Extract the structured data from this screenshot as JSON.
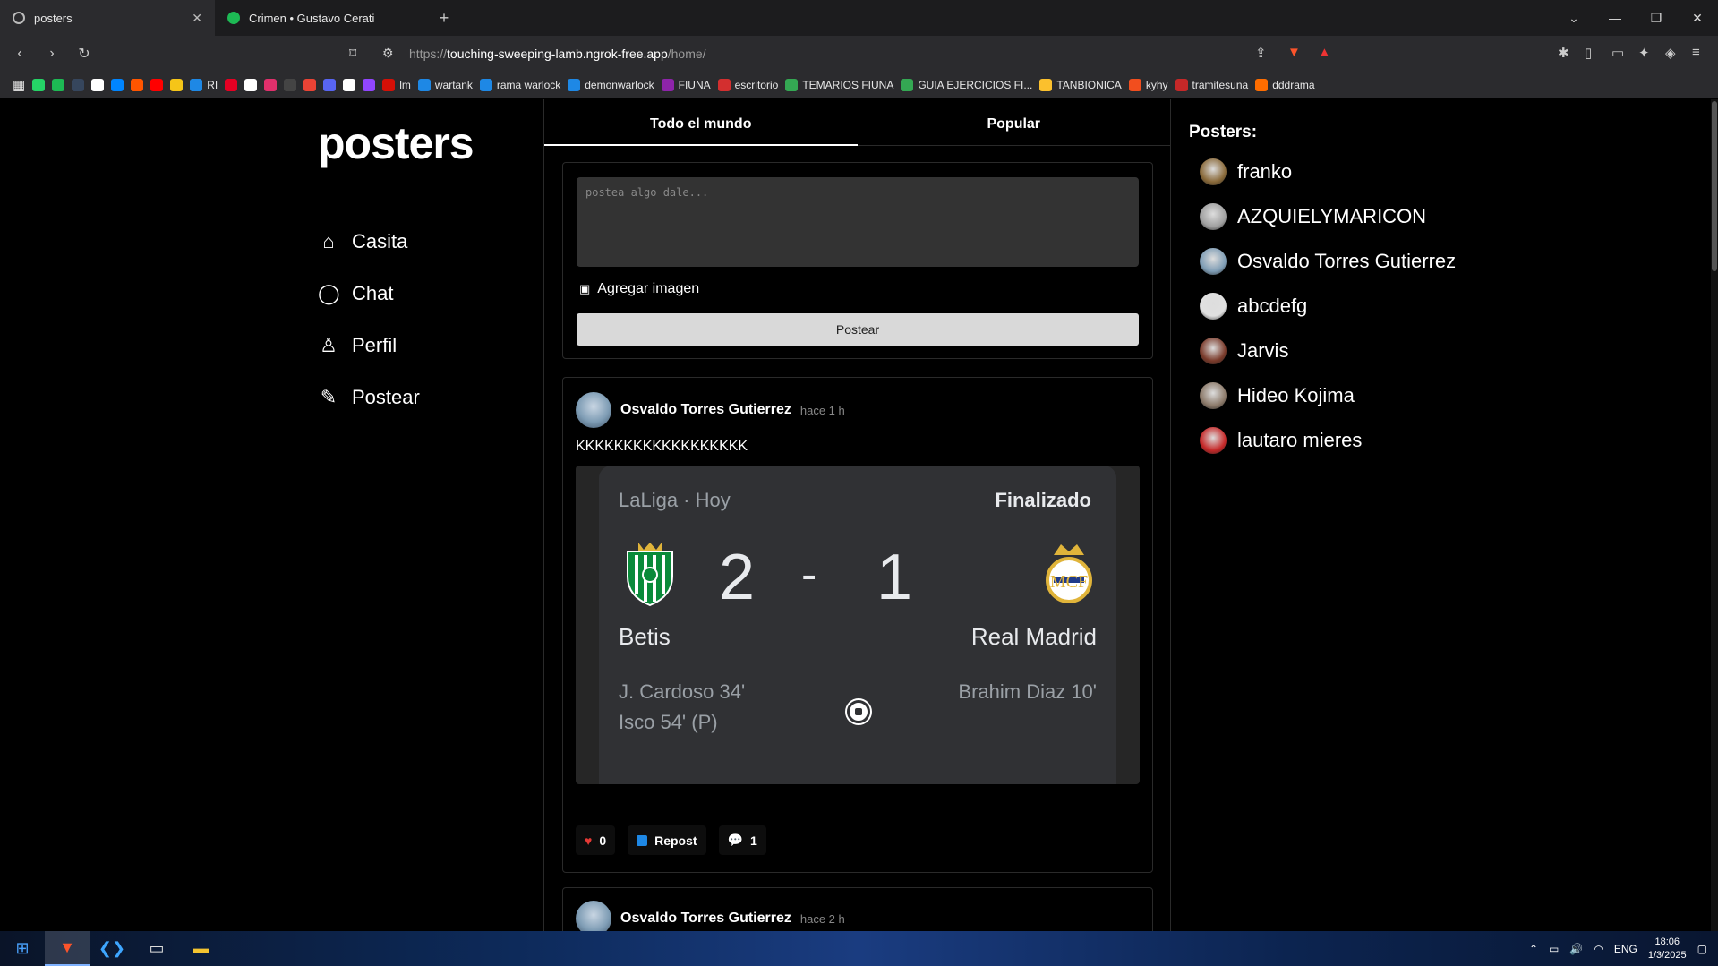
{
  "browser": {
    "tabs": [
      {
        "title": "posters",
        "active": true
      },
      {
        "title": "Crimen • Gustavo Cerati",
        "active": false
      }
    ],
    "url_prefix": "https://",
    "url_host": "touching-sweeping-lamb.ngrok-free.app",
    "url_path": "/home/",
    "bookmarks": [
      {
        "label": "",
        "color": "#25d366"
      },
      {
        "label": "",
        "color": "#1db954"
      },
      {
        "label": "",
        "color": "#36465d"
      },
      {
        "label": "",
        "color": "#ffffff"
      },
      {
        "label": "",
        "color": "#0085ff"
      },
      {
        "label": "",
        "color": "#ff5500"
      },
      {
        "label": "",
        "color": "#ff0000"
      },
      {
        "label": "",
        "color": "#f5c518"
      },
      {
        "label": "RI",
        "color": "#1e88e5"
      },
      {
        "label": "",
        "color": "#e60023"
      },
      {
        "label": "",
        "color": "#ffffff"
      },
      {
        "label": "",
        "color": "#e1306c"
      },
      {
        "label": "",
        "color": "#444444"
      },
      {
        "label": "",
        "color": "#ea4335"
      },
      {
        "label": "",
        "color": "#5865f2"
      },
      {
        "label": "",
        "color": "#ffffff"
      },
      {
        "label": "",
        "color": "#9146ff"
      },
      {
        "label": "lm",
        "color": "#d51007"
      },
      {
        "label": "wartank",
        "color": "#1e88e5"
      },
      {
        "label": "rama warlock",
        "color": "#1e88e5"
      },
      {
        "label": "demonwarlock",
        "color": "#1e88e5"
      },
      {
        "label": "FIUNA",
        "color": "#8e24aa"
      },
      {
        "label": "escritorio",
        "color": "#d32f2f"
      },
      {
        "label": "TEMARIOS FIUNA",
        "color": "#34a853"
      },
      {
        "label": "GUIA EJERCICIOS FI...",
        "color": "#34a853"
      },
      {
        "label": "TANBIONICA",
        "color": "#fbc02d"
      },
      {
        "label": "kyhy",
        "color": "#f24e1e"
      },
      {
        "label": "tramitesuna",
        "color": "#c62828"
      },
      {
        "label": "dddrama",
        "color": "#ff6d00"
      }
    ]
  },
  "sidebar": {
    "logo": "posters",
    "items": [
      {
        "label": "Casita",
        "icon": "home-icon"
      },
      {
        "label": "Chat",
        "icon": "chat-icon"
      },
      {
        "label": "Perfil",
        "icon": "user-icon"
      },
      {
        "label": "Postear",
        "icon": "pencil-icon"
      }
    ]
  },
  "feed": {
    "tabs": [
      "Todo el mundo",
      "Popular"
    ],
    "composer": {
      "placeholder": "postea algo dale...",
      "add_image": "Agregar imagen",
      "submit": "Postear"
    },
    "posts": [
      {
        "author": "Osvaldo Torres Gutierrez",
        "time": "hace 1 h",
        "text": "KKKKKKKKKKKKKKKKKK",
        "likes": "0",
        "repost": "Repost",
        "comments": "1",
        "match": {
          "league": "LaLiga · Hoy",
          "status": "Finalizado",
          "home_team": "Betis",
          "away_team": "Real Madrid",
          "home_score": "2",
          "separator": "-",
          "away_score": "1",
          "home_scorers": [
            "J. Cardoso 34'",
            "Isco 54' (P)"
          ],
          "away_scorers": [
            "Brahim Diaz 10'"
          ]
        }
      },
      {
        "author": "Osvaldo Torres Gutierrez",
        "time": "hace 2 h"
      }
    ]
  },
  "right": {
    "title": "Posters:",
    "users": [
      {
        "name": "franko",
        "color": "#8a6a3a"
      },
      {
        "name": "AZQUIELYMARICON",
        "color": "#a0a0a0"
      },
      {
        "name": "Osvaldo Torres Gutierrez",
        "color": "#7f9db5"
      },
      {
        "name": "abcdefg",
        "color": "#e0e0e0"
      },
      {
        "name": "Jarvis",
        "color": "#7a3a2a"
      },
      {
        "name": "Hideo Kojima",
        "color": "#8c7a6a"
      },
      {
        "name": "lautaro mieres",
        "color": "#c62828"
      }
    ]
  },
  "taskbar": {
    "lang": "ENG",
    "time": "18:06",
    "date": "1/3/2025"
  }
}
